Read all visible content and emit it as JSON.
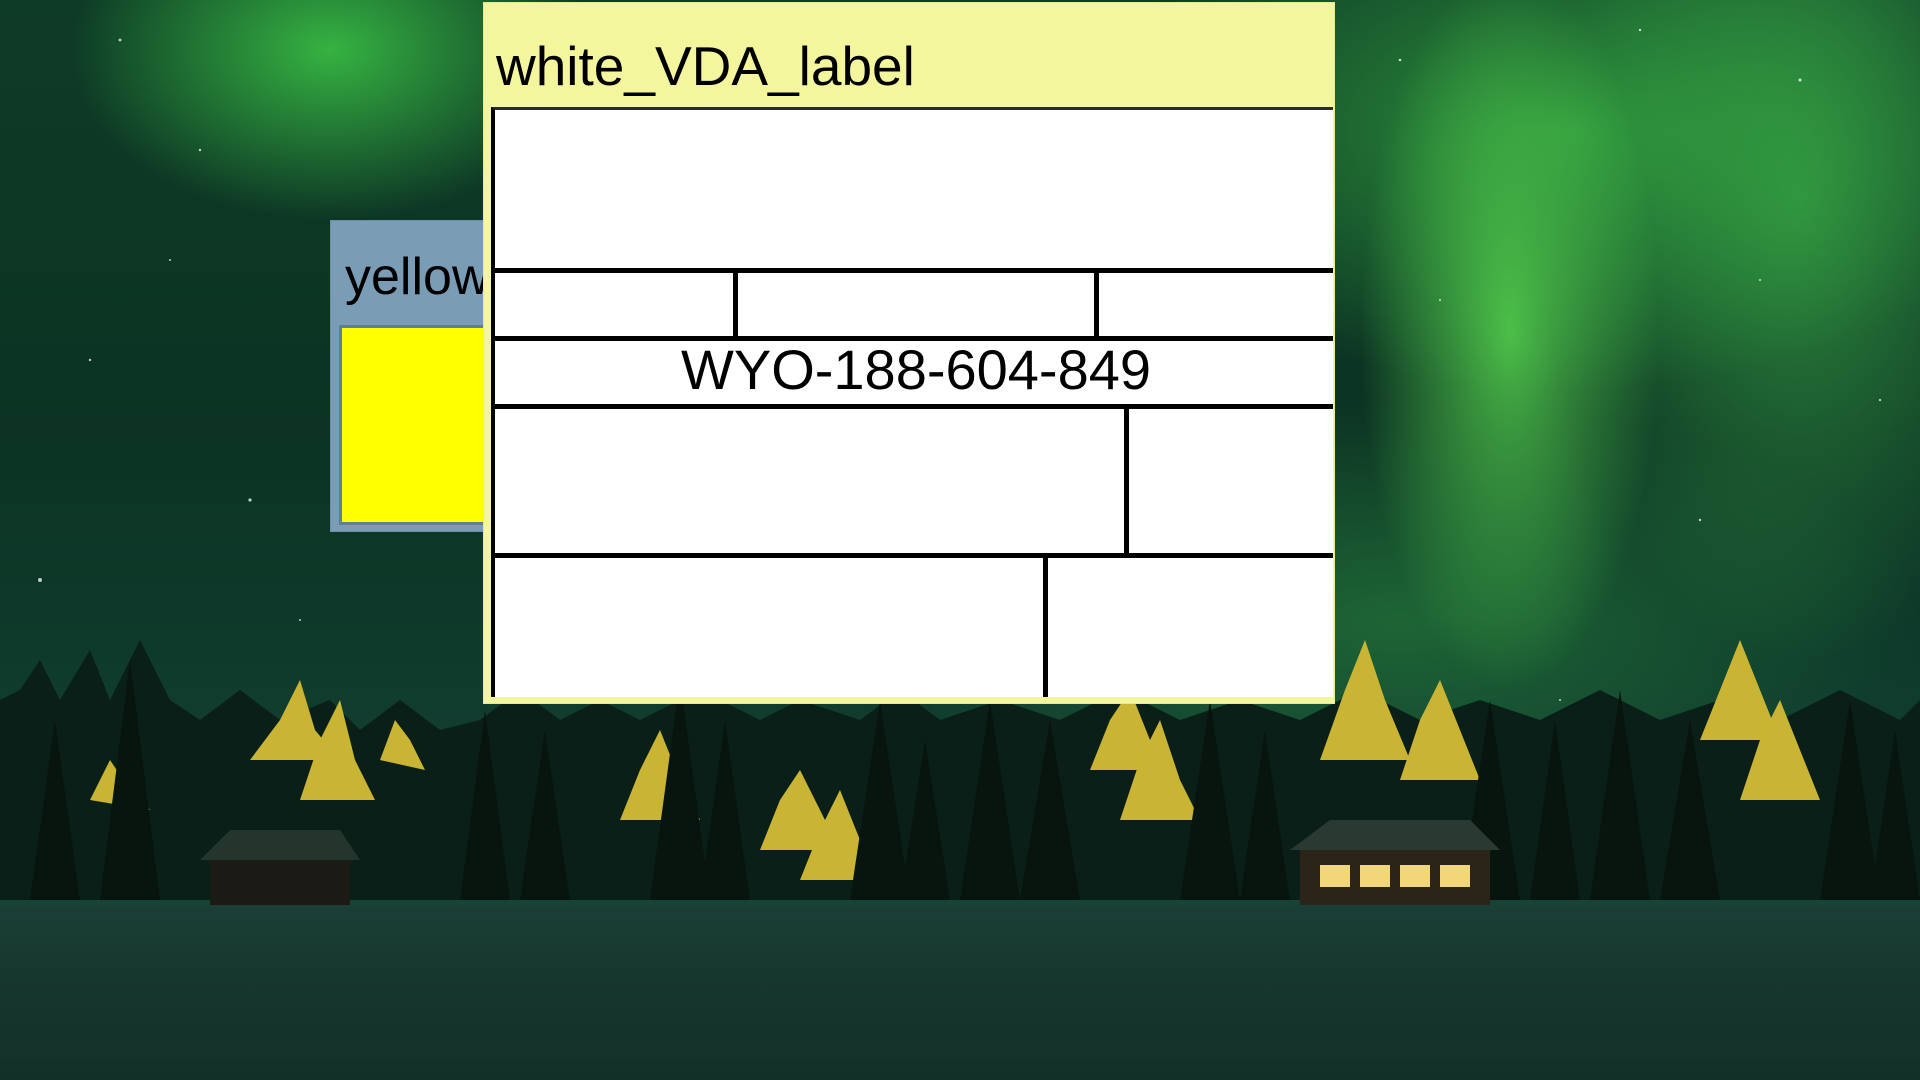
{
  "desktop": {
    "wallpaper": "aurora-forest-night"
  },
  "windows": {
    "yellow": {
      "title": "yellow",
      "fill_color": "#ffff00",
      "titlebar_color": "#7a9cb4"
    },
    "white_label": {
      "title": "white_VDA_label",
      "titlebar_color": "#f4f69e",
      "tracking_number": "WYO-188-604-849"
    }
  }
}
